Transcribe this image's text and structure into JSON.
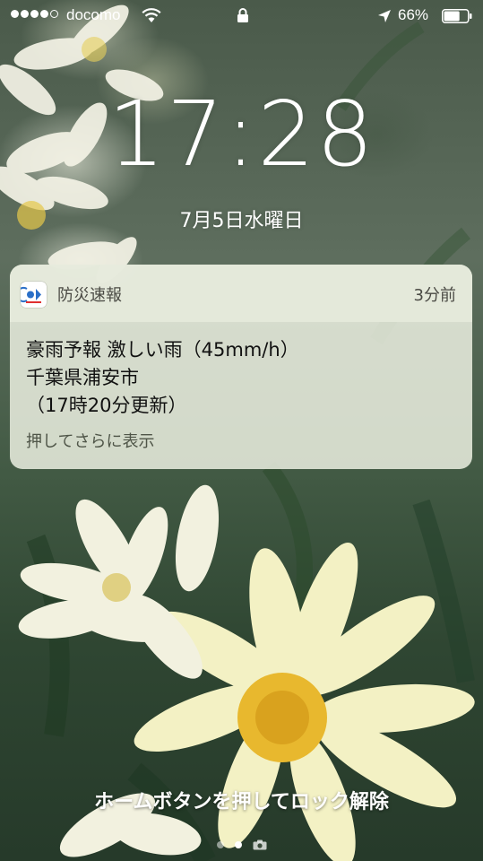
{
  "status_bar": {
    "carrier": "docomo",
    "battery_percent": "66%",
    "battery_level": 0.66,
    "signal_bars_filled": 4,
    "signal_bars_total": 5
  },
  "lock_screen": {
    "time": "17:28",
    "date": "7月5日水曜日",
    "unlock_hint": "ホームボタンを押してロック解除"
  },
  "notification": {
    "app_name": "防災速報",
    "time_ago": "3分前",
    "lines": [
      "豪雨予報 激しい雨（45mm/h）",
      "千葉県浦安市",
      "（17時20分更新）"
    ],
    "more_label": "押してさらに表示"
  },
  "page_indicator": {
    "pages": 2,
    "active_index": 1
  },
  "colors": {
    "notification_bg": "#eef2e4",
    "text": "#111111",
    "white": "#ffffff"
  },
  "icons": [
    "wifi-icon",
    "lock-icon",
    "location-arrow-icon",
    "battery-icon",
    "app-icon",
    "camera-icon"
  ]
}
